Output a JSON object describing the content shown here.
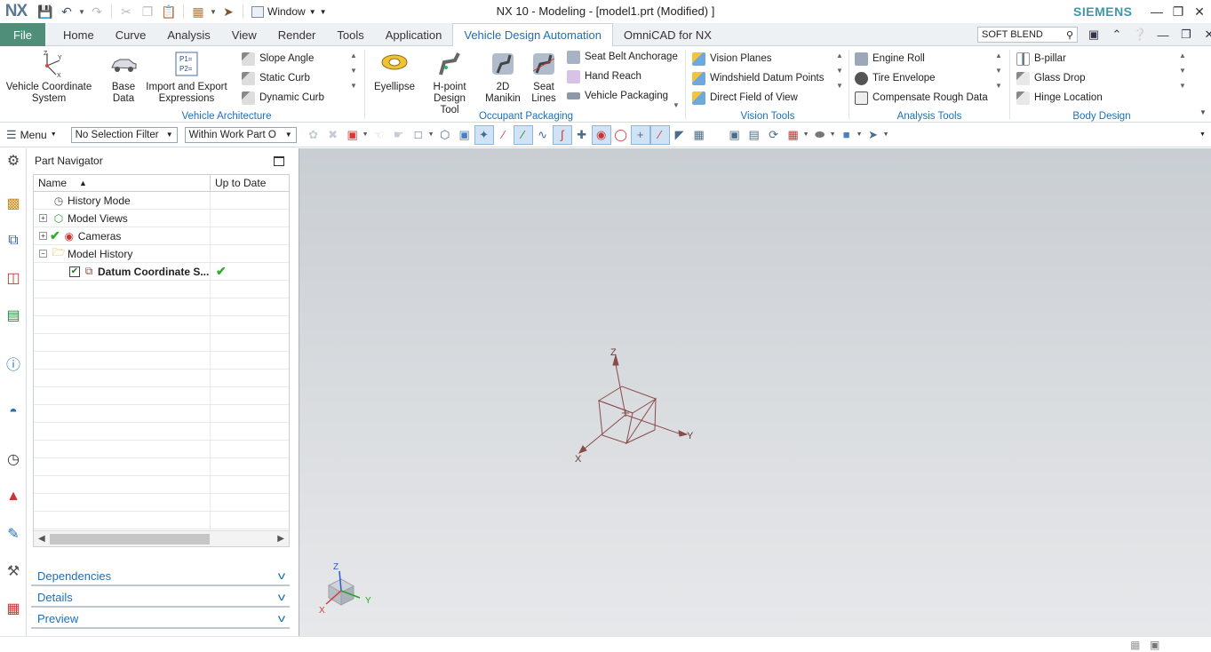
{
  "app": {
    "logo": "NX",
    "title": "NX 10 - Modeling - [model1.prt (Modified) ]",
    "brand": "SIEMENS",
    "window_menu": "Window"
  },
  "tabs": {
    "file": "File",
    "items": [
      "Home",
      "Curve",
      "Analysis",
      "View",
      "Render",
      "Tools",
      "Application",
      "Vehicle Design Automation",
      "OmniCAD for NX"
    ],
    "active": "Vehicle Design Automation",
    "command_finder": "SOFT BLEND"
  },
  "ribbon": {
    "vehicle_architecture": {
      "label": "Vehicle Architecture",
      "vcs": "Vehicle Coordinate System",
      "base_data": "Base Data",
      "import_export": "Import and Export Expressions",
      "items": [
        "Slope Angle",
        "Static Curb",
        "Dynamic Curb"
      ]
    },
    "occupant_packaging": {
      "label": "Occupant Packaging",
      "eyellipse": "Eyellipse",
      "hpoint": "H-point Design Tool",
      "manikin": "2D Manikin",
      "seat_lines": "Seat Lines",
      "items": [
        "Seat Belt Anchorage",
        "Hand Reach",
        "Vehicle Packaging"
      ]
    },
    "vision_tools": {
      "label": "Vision Tools",
      "items": [
        "Vision Planes",
        "Windshield Datum Points",
        "Direct Field of View"
      ]
    },
    "analysis_tools": {
      "label": "Analysis Tools",
      "items": [
        "Engine Roll",
        "Tire Envelope",
        "Compensate Rough Data"
      ]
    },
    "body_design": {
      "label": "Body Design",
      "items": [
        "B-pillar",
        "Glass Drop",
        "Hinge Location"
      ]
    }
  },
  "toolbar": {
    "menu": "Menu",
    "selection_filter": "No Selection Filter",
    "scope": "Within Work Part O"
  },
  "navigator": {
    "title": "Part Navigator",
    "col_name": "Name",
    "col_uptodate": "Up to Date",
    "rows": [
      {
        "label": "History Mode"
      },
      {
        "label": "Model Views"
      },
      {
        "label": "Cameras"
      },
      {
        "label": "Model History"
      },
      {
        "label": "Datum Coordinate S..."
      }
    ],
    "panels": [
      "Dependencies",
      "Details",
      "Preview"
    ]
  },
  "graphics": {
    "axis_x": "X",
    "axis_y": "Y",
    "axis_z": "Z"
  },
  "colors": {
    "accent": "#1f6fb4",
    "file_tab": "#4f8f7a",
    "brand": "#3c9aa8",
    "datum": "#8b4a4a"
  }
}
